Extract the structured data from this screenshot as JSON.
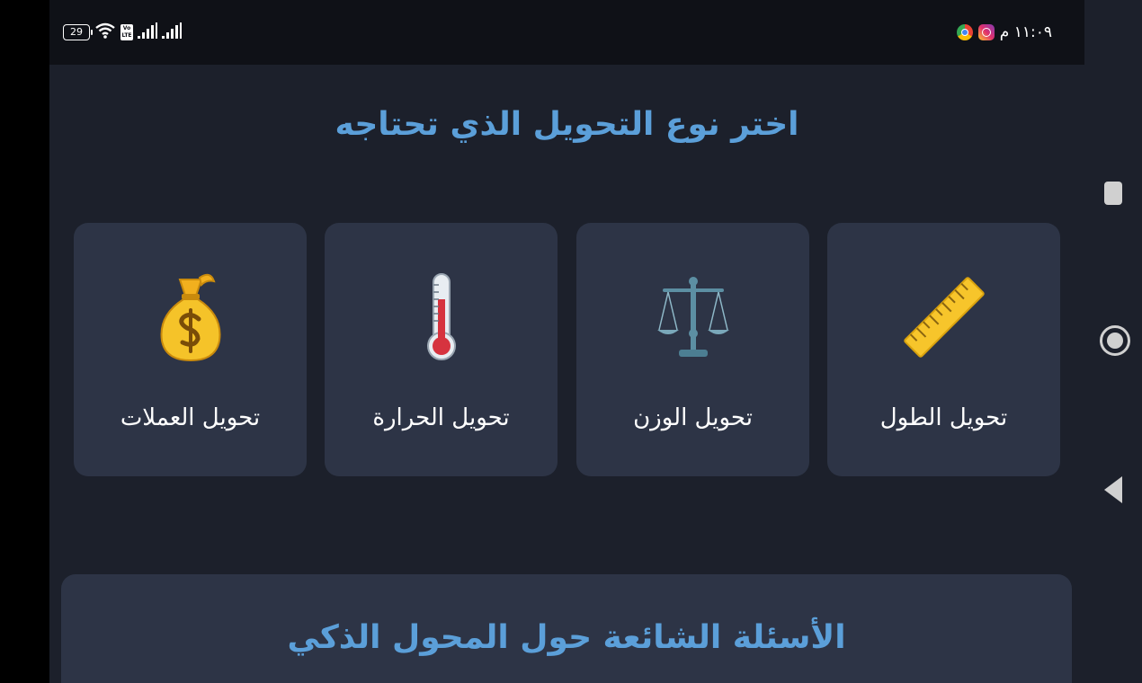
{
  "status_bar": {
    "battery_level": "29",
    "volte_label_top": "Vo",
    "volte_label_bottom": "LTE",
    "time": "١١:٠٩ م",
    "icons": [
      "battery-icon",
      "wifi-icon",
      "volte-icon",
      "signal-icon",
      "signal-icon",
      "chrome-icon",
      "instagram-icon"
    ]
  },
  "page": {
    "title": "اختر نوع التحويل الذي تحتاجه"
  },
  "conversion_cards": [
    {
      "label": "تحويل الطول",
      "icon": "ruler-icon"
    },
    {
      "label": "تحويل الوزن",
      "icon": "scales-icon"
    },
    {
      "label": "تحويل الحرارة",
      "icon": "thermometer-icon"
    },
    {
      "label": "تحويل العملات",
      "icon": "money-bag-icon"
    }
  ],
  "faq": {
    "title": "الأسئلة الشائعة حول المحول الذكي"
  },
  "navigation": {
    "icons": [
      "recent-apps-icon",
      "home-icon",
      "back-icon"
    ]
  },
  "colors": {
    "background": "#1c202b",
    "status_bar": "#0f1117",
    "card": "#2d3446",
    "title_accent": "#5b9fd9",
    "text": "#ffffff"
  }
}
